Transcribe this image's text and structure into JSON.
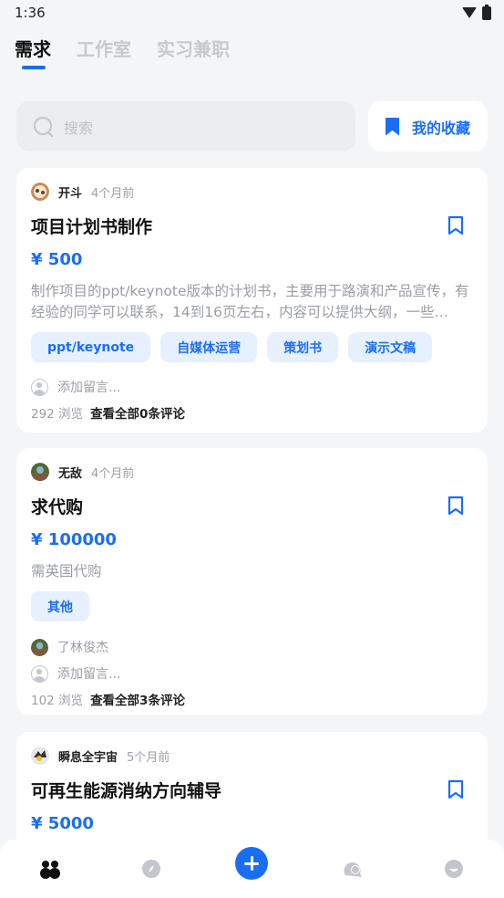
{
  "status_bar": {
    "time": "1:36"
  },
  "tabs": [
    {
      "label": "需求",
      "active": true
    },
    {
      "label": "工作室",
      "active": false
    },
    {
      "label": "实习兼职",
      "active": false
    }
  ],
  "search": {
    "placeholder": "搜索"
  },
  "favorites": {
    "label": "我的收藏"
  },
  "posts": [
    {
      "author": "开斗",
      "time": "4个月前",
      "title": "项目计划书制作",
      "price": "¥ 500",
      "description": "制作项目的ppt/keynote版本的计划书，主要用于路演和产品宣传，有经验的同学可以联系，14到16页左右，内容可以提供大纲，一些…",
      "tags": [
        "ppt/keynote",
        "自媒体运营",
        "策划书",
        "演示文稿"
      ],
      "comment_placeholder": "添加留言...",
      "views": "292 浏览",
      "see_all": "查看全部0条评论"
    },
    {
      "author": "无敌",
      "time": "4个月前",
      "title": "求代购",
      "price": "¥ 100000",
      "description": "需英国代购",
      "tags": [
        "其他"
      ],
      "commenter": "了林俊杰",
      "comment_placeholder": "添加留言...",
      "views": "102 浏览",
      "see_all": "查看全部3条评论"
    },
    {
      "author": "瞬息全宇宙",
      "time": "5个月前",
      "title": "可再生能源消纳方向辅导",
      "price": "¥ 5000"
    }
  ],
  "colors": {
    "accent": "#1a6ef5",
    "background": "#f4f5f7",
    "tag_bg": "#e7f0ff"
  },
  "bottom_nav": [
    "people-icon",
    "compass-icon",
    "plus-icon",
    "chat-icon",
    "smile-icon"
  ]
}
